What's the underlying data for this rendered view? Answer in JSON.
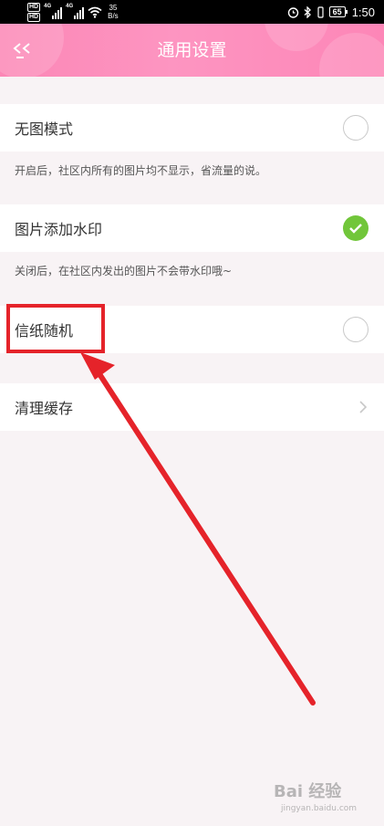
{
  "status_bar": {
    "hd_badge": "HD",
    "network_1": "4G",
    "network_2": "4G",
    "speed_value": "35",
    "speed_unit": "B/s",
    "battery": "65",
    "time": "1:50"
  },
  "header": {
    "title": "通用设置",
    "back_icon": "back-arrow-icon",
    "gradient_colors": [
      "#fc87b6",
      "#fd95c1"
    ]
  },
  "settings": [
    {
      "label": "无图模式",
      "control": "radio",
      "checked": false,
      "description": "开启后，社区内所有的图片均不显示，省流量的说。"
    },
    {
      "label": "图片添加水印",
      "control": "check",
      "checked": true,
      "description": "关闭后，在社区内发出的图片不会带水印哦~"
    },
    {
      "label": "信纸随机",
      "control": "radio",
      "checked": false
    },
    {
      "label": "清理缓存",
      "control": "chevron"
    }
  ],
  "colors": {
    "accent_pink": "#fd8fbd",
    "check_green": "#71c63a",
    "annotation_red": "#e5232a"
  },
  "watermark": {
    "line1": "Bai 经验",
    "line2": "jingyan.baidu.com"
  }
}
